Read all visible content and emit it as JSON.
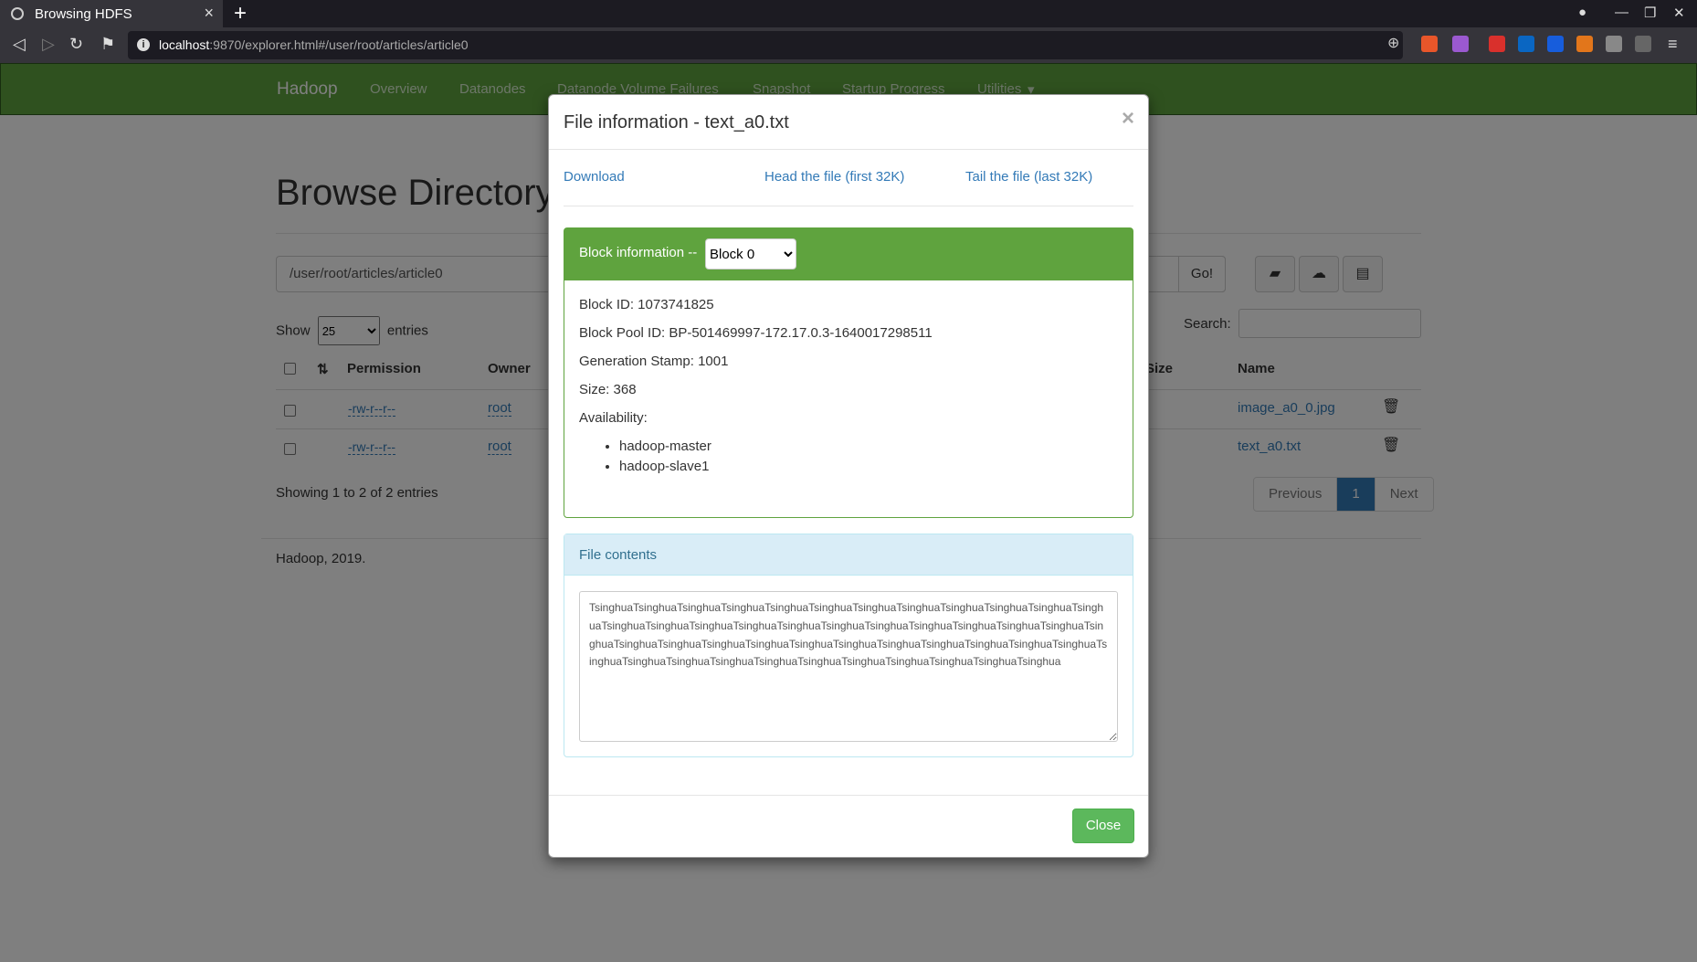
{
  "browser": {
    "tab_title": "Browsing HDFS",
    "url_host": "localhost",
    "url_path": ":9870/explorer.html#/user/root/articles/article0"
  },
  "navbar": {
    "brand": "Hadoop",
    "items": [
      "Overview",
      "Datanodes",
      "Datanode Volume Failures",
      "Snapshot",
      "Startup Progress",
      "Utilities"
    ]
  },
  "page": {
    "title": "Browse Directory",
    "path_value": "/user/root/articles/article0",
    "go_label": "Go!",
    "show_label": "Show",
    "entries_label": "entries",
    "page_size": "25",
    "search_label": "Search:",
    "columns": {
      "permission": "Permission",
      "owner": "Owner",
      "size": "Size",
      "name": "Name"
    },
    "rows": [
      {
        "permission": "-rw-r--r--",
        "owner": "root",
        "name": "image_a0_0.jpg"
      },
      {
        "permission": "-rw-r--r--",
        "owner": "root",
        "name": "text_a0.txt"
      }
    ],
    "info": "Showing 1 to 2 of 2 entries",
    "pager": {
      "previous": "Previous",
      "current": "1",
      "next": "Next"
    },
    "footer": "Hadoop, 2019."
  },
  "modal": {
    "title": "File information - text_a0.txt",
    "close_x": "×",
    "download": "Download",
    "head": "Head the file (first 32K)",
    "tail": "Tail the file (last 32K)",
    "block_label": "Block information --",
    "block_selected": "Block 0",
    "block_id": "Block ID: 1073741825",
    "block_pool": "Block Pool ID: BP-501469997-172.17.0.3-1640017298511",
    "gen_stamp": "Generation Stamp: 1001",
    "size": "Size: 368",
    "availability": "Availability:",
    "hosts": [
      "hadoop-master",
      "hadoop-slave1"
    ],
    "contents_label": "File contents",
    "contents": "TsinghuaTsinghuaTsinghuaTsinghuaTsinghuaTsinghuaTsinghuaTsinghuaTsinghuaTsinghuaTsinghuaTsinghuaTsinghuaTsinghuaTsinghuaTsinghuaTsinghuaTsinghuaTsinghuaTsinghuaTsinghuaTsinghuaTsinghuaTsinghuaTsinghuaTsinghuaTsinghuaTsinghuaTsinghuaTsinghuaTsinghuaTsinghuaTsinghuaTsinghuaTsinghuaTsinghuaTsinghuaTsinghuaTsinghuaTsinghuaTsinghuaTsinghuaTsinghuaTsinghuaTsinghuaTsinghua",
    "close_button": "Close"
  }
}
